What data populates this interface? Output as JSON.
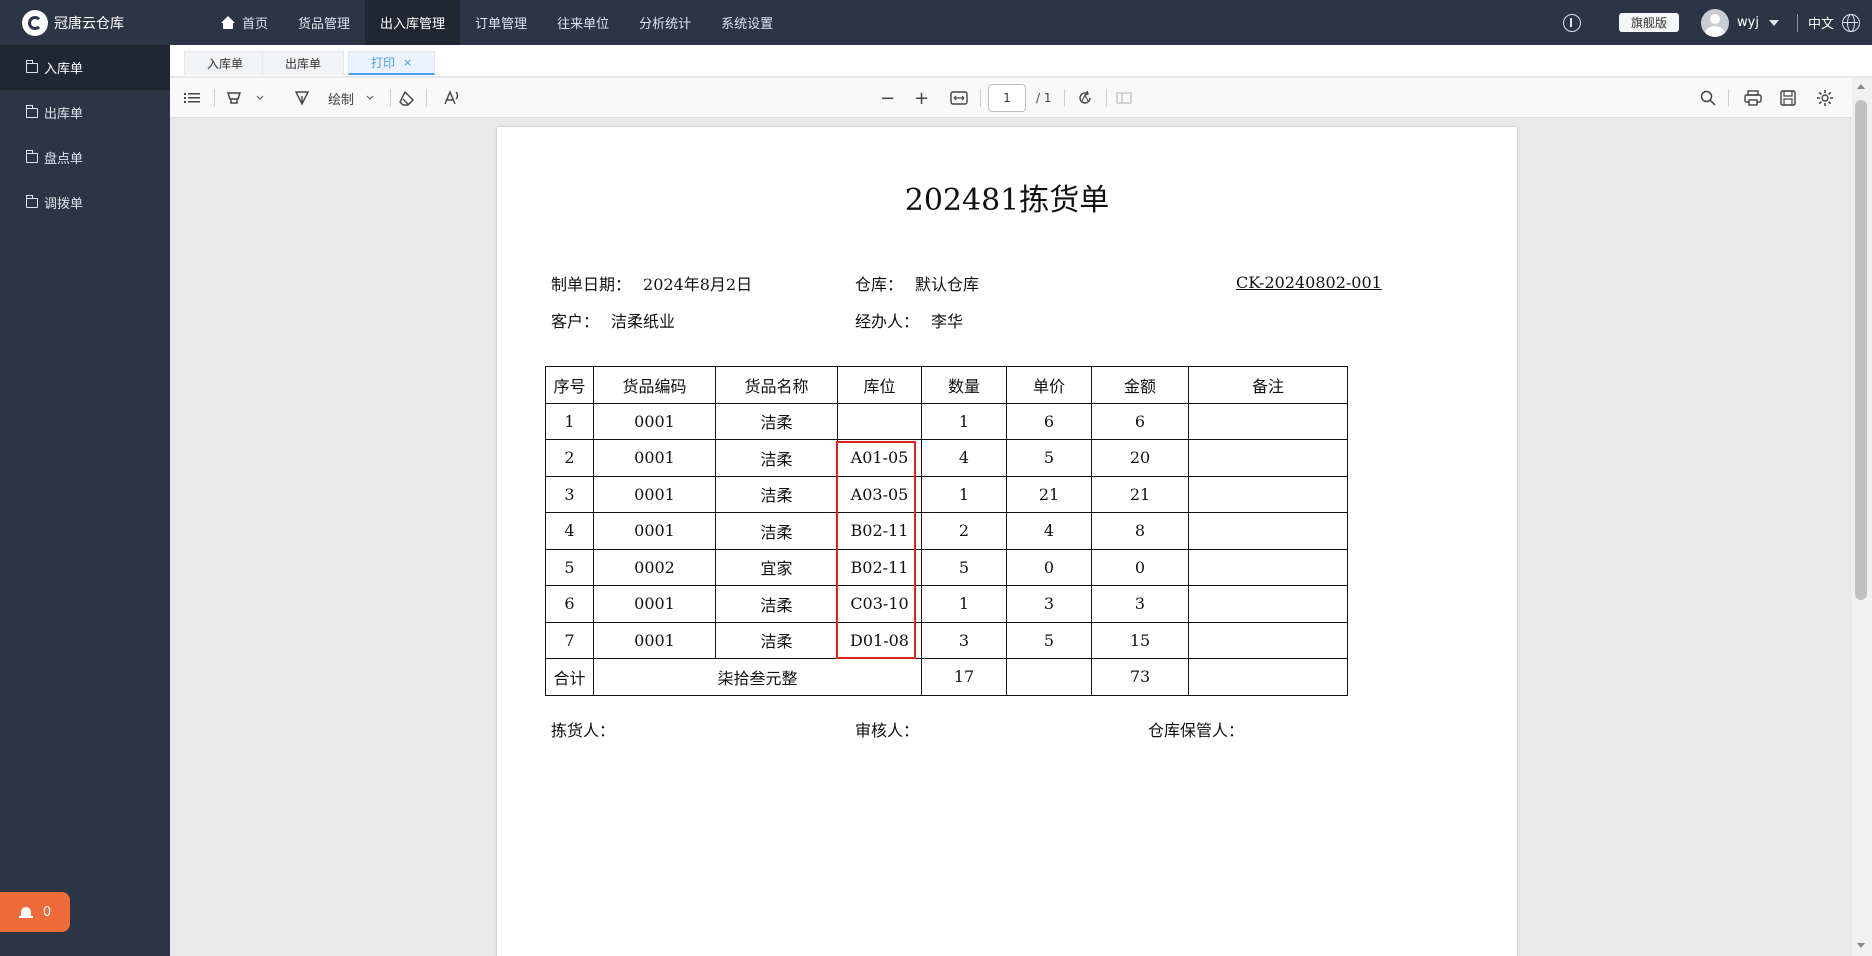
{
  "app": {
    "brand": "冠唐云仓库",
    "nav": [
      "首页",
      "货品管理",
      "出入库管理",
      "订单管理",
      "往来单位",
      "分析统计",
      "系统设置"
    ],
    "edition": "旗舰版",
    "username": "wyj",
    "language": "中文"
  },
  "sidebar": {
    "items": [
      "入库单",
      "出库单",
      "盘点单",
      "调拨单"
    ],
    "alarm_count": "0"
  },
  "tabs": [
    {
      "label": "入库单"
    },
    {
      "label": "出库单"
    },
    {
      "label": "打印",
      "close": "×"
    }
  ],
  "pdf_toolbar": {
    "draw_label": "绘制",
    "page_value": "1",
    "page_total": "/ 1",
    "zoom_out": "−",
    "zoom_in": "+"
  },
  "document": {
    "title": "202481拣货单",
    "date_label": "制单日期：",
    "date_value": "2024年8月2日",
    "warehouse_label": "仓库：",
    "warehouse_value": "默认仓库",
    "doc_no": "CK-20240802-001",
    "customer_label": "客户：",
    "customer_value": "洁柔纸业",
    "handler_label": "经办人：",
    "handler_value": "李华",
    "headers": [
      "序号",
      "货品编码",
      "货品名称",
      "库位",
      "数量",
      "单价",
      "金额",
      "备注"
    ],
    "rows": [
      [
        "1",
        "0001",
        "洁柔",
        "",
        "1",
        "6",
        "6",
        ""
      ],
      [
        "2",
        "0001",
        "洁柔",
        "A01-05",
        "4",
        "5",
        "20",
        ""
      ],
      [
        "3",
        "0001",
        "洁柔",
        "A03-05",
        "1",
        "21",
        "21",
        ""
      ],
      [
        "4",
        "0001",
        "洁柔",
        "B02-11",
        "2",
        "4",
        "8",
        ""
      ],
      [
        "5",
        "0002",
        "宜家",
        "B02-11",
        "5",
        "0",
        "0",
        ""
      ],
      [
        "6",
        "0001",
        "洁柔",
        "C03-10",
        "1",
        "3",
        "3",
        ""
      ],
      [
        "7",
        "0001",
        "洁柔",
        "D01-08",
        "3",
        "5",
        "15",
        ""
      ]
    ],
    "total": {
      "label": "合计",
      "amount_words": "柒拾叁元整",
      "qty": "17",
      "unit_price": "",
      "amount": "73",
      "remark": ""
    },
    "picker_label": "拣货人：",
    "reviewer_label": "审核人：",
    "keeper_label": "仓库保管人："
  },
  "colors": {
    "topbar": "#2c3545",
    "accent": "#4a9bf5",
    "alarm": "#ef6c3a",
    "highlight": "#e0241b"
  }
}
